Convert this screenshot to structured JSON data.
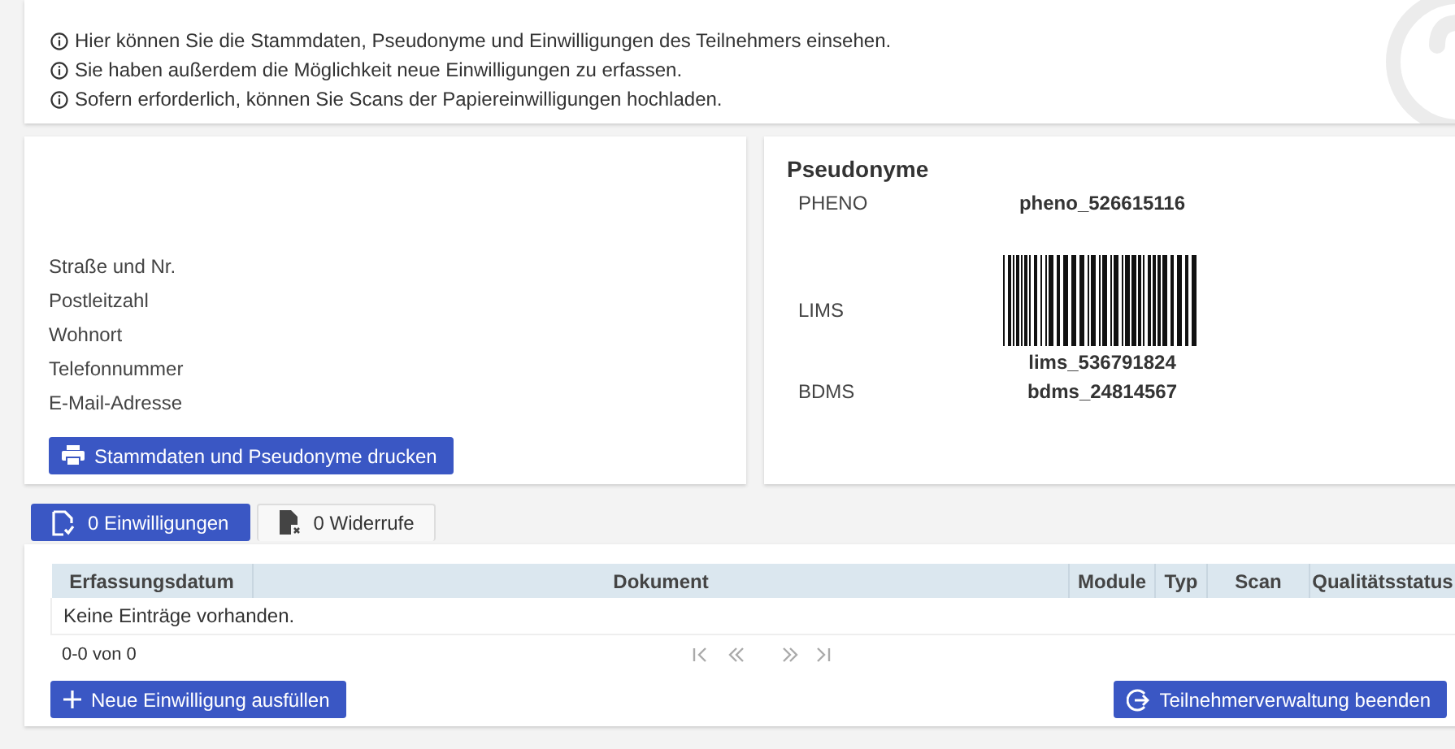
{
  "info": {
    "lines": [
      "Hier können Sie die Stammdaten, Pseudonyme und Einwilligungen des Teilnehmers einsehen.",
      "Sie haben außerdem die Möglichkeit neue Einwilligungen zu erfassen.",
      "Sofern erforderlich, können Sie Scans der Papiereinwilligungen hochladen."
    ]
  },
  "stammdaten": {
    "fields": [
      "Straße und Nr.",
      "Postleitzahl",
      "Wohnort",
      "Telefonnummer",
      "E-Mail-Adresse"
    ],
    "print_button": "Stammdaten und Pseudonyme drucken"
  },
  "pseudonyme": {
    "title": "Pseudonyme",
    "items": [
      {
        "label": "PHENO",
        "value": "pheno_526615116",
        "kind": "text"
      },
      {
        "label": "LIMS",
        "value": "lims_536791824",
        "kind": "barcode"
      },
      {
        "label": "BDMS",
        "value": "bdms_24814567",
        "kind": "text"
      }
    ]
  },
  "tabs": [
    {
      "label": "0 Einwilligungen",
      "selected": true,
      "kind": "consent"
    },
    {
      "label": "0 Widerrufe",
      "selected": false,
      "kind": "revocation"
    }
  ],
  "table": {
    "columns": [
      "Erfassungsdatum",
      "Dokument",
      "Module",
      "Typ",
      "Scan",
      "Qualitätsstatus"
    ],
    "empty_message": "Keine Einträge vorhanden.",
    "pager_text": "0-0 von 0"
  },
  "buttons": [
    {
      "label": "Neue Einwilligung ausfüllen",
      "kind": "add"
    },
    {
      "label": "Teilnehmerverwaltung beenden",
      "kind": "exit"
    }
  ]
}
